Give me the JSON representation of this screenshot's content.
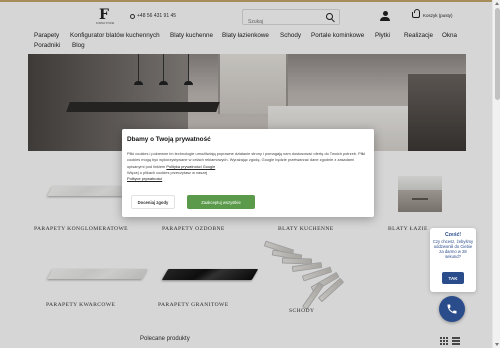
{
  "header": {
    "logo_text": "F",
    "logo_sub": "FORMA STONE",
    "phone": "+48 56 431 91 45",
    "search_placeholder": "Szukaj",
    "cart_label": "Koszyk (pusty)"
  },
  "nav": {
    "items": [
      "Parapety",
      "Konfigurator blatów kuchennych",
      "Blaty kuchenne",
      "Blaty łazienkowe",
      "Schody",
      "Portale kominkowe",
      "Płytki",
      "Realizacje",
      "Okna",
      "Poradniki",
      "Blog"
    ]
  },
  "categories": [
    {
      "label": "Parapety konglomeratowe"
    },
    {
      "label": "Parapety ozdobne"
    },
    {
      "label": "Blaty kuchenne"
    },
    {
      "label": "Blaty łazie"
    },
    {
      "label": "Parapety kwarcowe"
    },
    {
      "label": "Parapety granitowe"
    },
    {
      "label": "Schody"
    }
  ],
  "recommended_title": "Polecane produkty",
  "cookie": {
    "title": "Dbamy o Twoją prywatność",
    "text_1": "Pliki cookies i pokrewne im technologie umożliwiają poprawne działanie strony i pomagają nam dostosować ofertę do Twoich potrzeb. Pliki cookies mogą być wykorzystywane w celach reklamowych. Wyrażając zgodę, Google będzie przetwarzać dane zgodnie z zasadami opisanymi pod linkiem",
    "link_google": "Polityka prywatności Google",
    "text_2": "Więcej o plikach cookies przeczytasz w naszej",
    "link_policy": "Polityce prywatności",
    "reject_label": "Doceniaj zgody",
    "accept_label": "Zaakceptuj wszystkie"
  },
  "chat": {
    "title": "Cześć!",
    "body": "Czy chcesz, żebyśmy oddzwonili do Ciebie za darmo w 28 sekund?",
    "button": "TAK"
  },
  "colors": {
    "accent_gold": "#c8a96b",
    "accept_green": "#5a9a4a",
    "chat_blue": "#2a4c8a"
  }
}
